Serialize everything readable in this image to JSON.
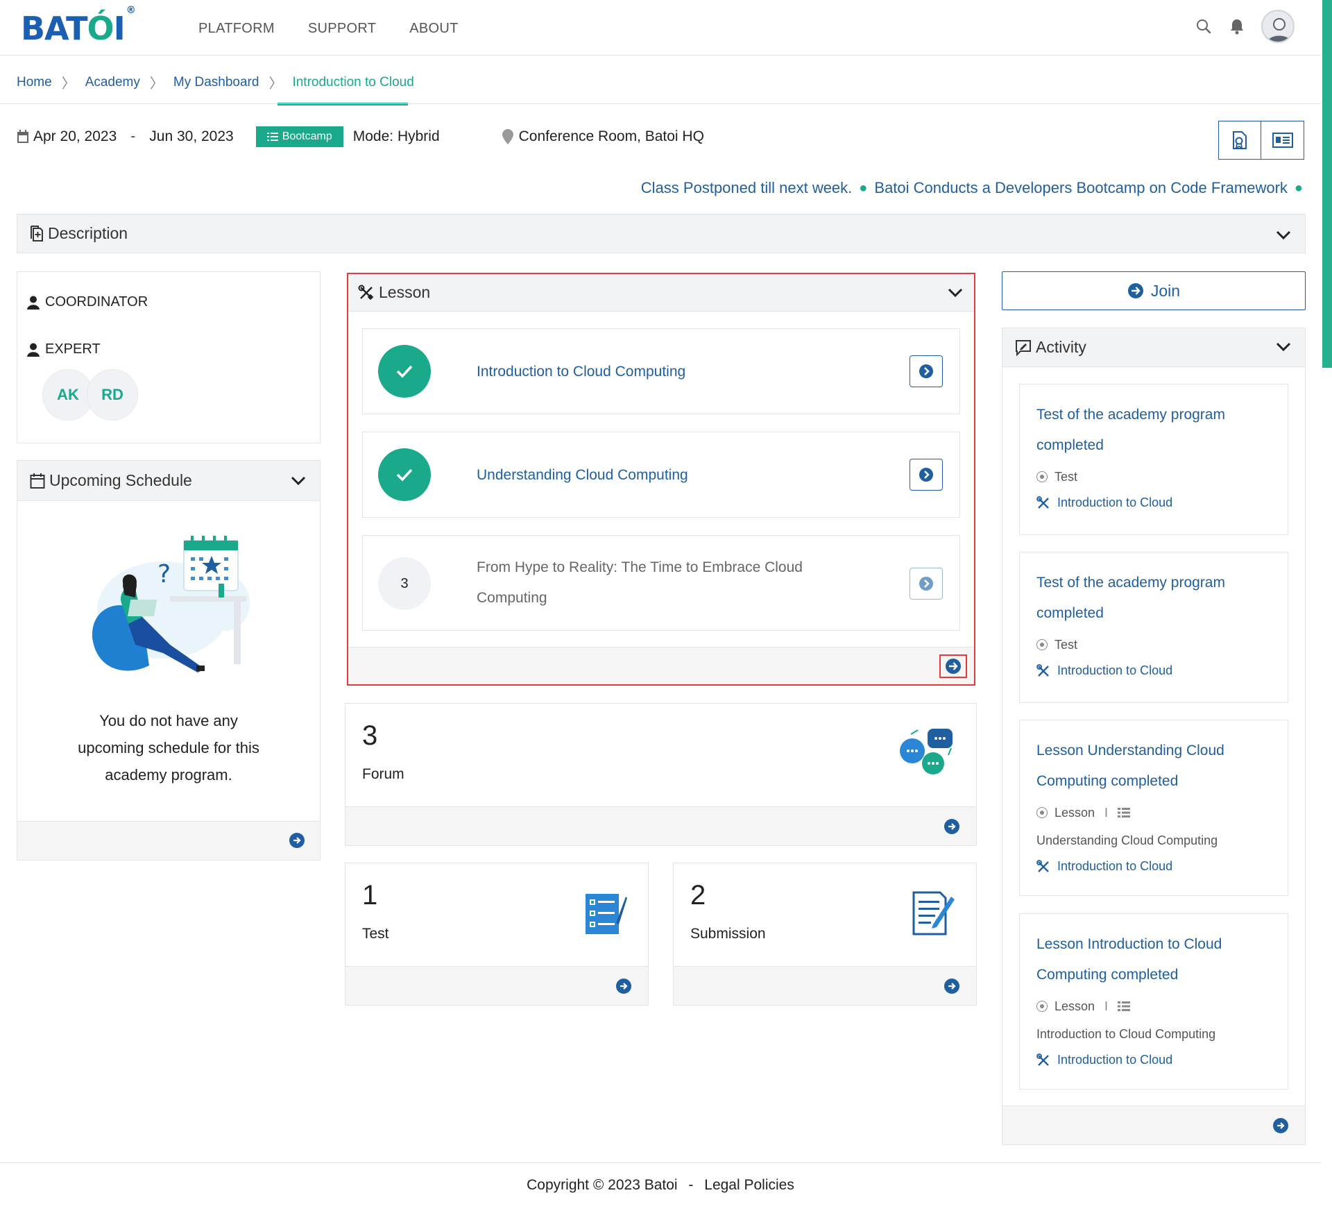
{
  "brand": {
    "logo_text": "BATOI",
    "registered": "®"
  },
  "nav": {
    "links": [
      "PLATFORM",
      "SUPPORT",
      "ABOUT"
    ]
  },
  "breadcrumb": [
    "Home",
    "Academy",
    "My Dashboard",
    "Introduction to Cloud"
  ],
  "course": {
    "start_date": "Apr 20, 2023",
    "date_separator": "-",
    "end_date": "Jun 30, 2023",
    "badge": "Bootcamp",
    "mode": "Mode: Hybrid",
    "location": "Conference Room, Batoi HQ"
  },
  "ticker": [
    "Class Postponed till next week.",
    "Batoi Conducts a Developers Bootcamp on Code Framework"
  ],
  "description": {
    "title": "Description"
  },
  "people": {
    "coordinator_label": "COORDINATOR",
    "expert_label": "EXPERT",
    "initials": [
      "AK",
      "RD"
    ]
  },
  "schedule": {
    "title": "Upcoming Schedule",
    "empty_message": "You do not have any upcoming schedule for this academy program."
  },
  "lesson": {
    "title": "Lesson",
    "items": [
      {
        "status": "done",
        "number": "",
        "title": "Introduction to Cloud Computing"
      },
      {
        "status": "done",
        "number": "",
        "title": "Understanding Cloud Computing"
      },
      {
        "status": "todo",
        "number": "3",
        "title": "From Hype to Reality: The Time to Embrace Cloud Computing"
      }
    ]
  },
  "stats": {
    "forum": {
      "count": "3",
      "label": "Forum"
    },
    "test": {
      "count": "1",
      "label": "Test"
    },
    "submission": {
      "count": "2",
      "label": "Submission"
    }
  },
  "join": {
    "label": "Join"
  },
  "activity": {
    "title": "Activity",
    "items": [
      {
        "title": "Test of the academy program completed",
        "type": "Test",
        "item": "",
        "course": "Introduction to Cloud"
      },
      {
        "title": "Test of the academy program completed",
        "type": "Test",
        "item": "",
        "course": "Introduction to Cloud"
      },
      {
        "title": "Lesson Understanding Cloud Computing completed",
        "type": "Lesson",
        "separator": "I",
        "item": "Understanding Cloud Computing",
        "course": "Introduction to Cloud"
      },
      {
        "title": "Lesson Introduction to Cloud Computing completed",
        "type": "Lesson",
        "separator": "I",
        "item": "Introduction to Cloud Computing",
        "course": "Introduction to Cloud"
      }
    ]
  },
  "footer": {
    "copyright": "Copyright © 2023 Batoi",
    "separator": "-",
    "legal": "Legal Policies"
  },
  "colors": {
    "primary": "#1f5fa0",
    "accent": "#1aa98a",
    "highlight": "#e23b3b"
  }
}
